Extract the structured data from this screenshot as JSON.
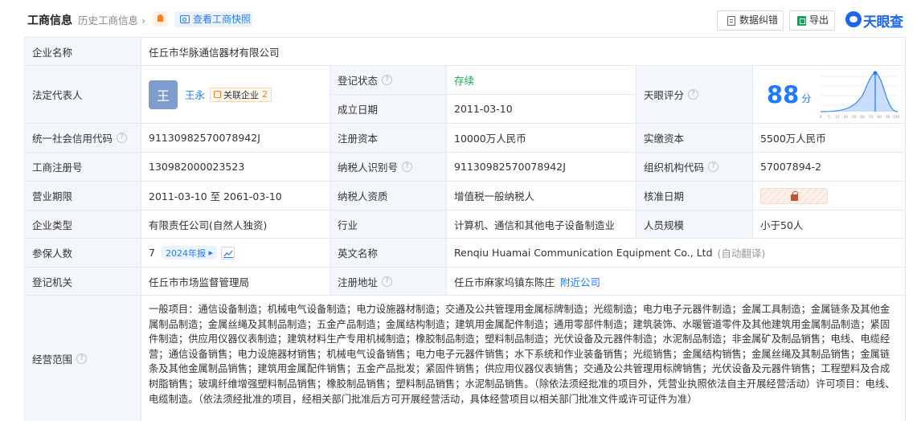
{
  "header": {
    "title": "工商信息",
    "history_link": "历史工商信息",
    "snapshot_button": "查看工商快照",
    "correct_button": "数据纠错",
    "export_button": "导出",
    "logo_text": "天眼查",
    "accent_color": "#1f7bff"
  },
  "company": {
    "name_label": "企业名称",
    "name": "任丘市华脉通信器材有限公司",
    "legal_rep_label": "法定代表人",
    "legal_rep_avatar": "王",
    "legal_rep_name": "王永",
    "related_label": "关联企业",
    "related_count": "2",
    "status_label": "登记状态",
    "status": "存续",
    "est_date_label": "成立日期",
    "est_date": "2011-03-10",
    "score_label": "天眼评分",
    "score": "88",
    "score_unit": "分",
    "score_axis": [
      "0",
      "5",
      "15",
      "30",
      "50",
      "60",
      "70",
      "80",
      "90",
      "100"
    ],
    "credit_code_label": "统一社会信用代码",
    "credit_code": "91130982570078942J",
    "reg_capital_label": "注册资本",
    "reg_capital": "10000万人民币",
    "paid_capital_label": "实缴资本",
    "paid_capital": "5500万人民币",
    "reg_no_label": "工商注册号",
    "reg_no": "130982000023523",
    "taxpayer_id_label": "纳税人识别号",
    "taxpayer_id": "91130982570078942J",
    "org_code_label": "组织机构代码",
    "org_code": "57007894-2",
    "term_label": "营业期限",
    "term": "2011-03-10 至 2061-03-10",
    "tax_qual_label": "纳税人资质",
    "tax_qual": "增值税一般纳税人",
    "approve_label": "核准日期",
    "type_label": "企业类型",
    "type": "有限责任公司(自然人独资)",
    "industry_label": "行业",
    "industry": "计算机、通信和其他电子设备制造业",
    "staff_label": "人员规模",
    "staff": "小于50人",
    "insured_label": "参保人数",
    "insured": "7",
    "insured_badge": "2024年报",
    "en_name_label": "英文名称",
    "en_name": "Renqiu Huamai Communication Equipment Co., Ltd",
    "auto_translate": "(自动翻译)",
    "authority_label": "登记机关",
    "authority": "任丘市市场监督管理局",
    "address_label": "注册地址",
    "address": "任丘市麻家坞镇东陈庄",
    "nearby_link": "附近公司",
    "scope_label": "经营范围",
    "scope": "一般项目：通信设备制造；机械电气设备制造；电力设施器材制造；交通及公共管理用金属标牌制造；光缆制造；电力电子元器件制造；金属工具制造；金属链条及其他金属制品制造；金属丝绳及其制品制造；五金产品制造；金属结构制造；建筑用金属配件制造；通用零部件制造；建筑装饰、水暖管道零件及其他建筑用金属制品制造；紧固件制造；供应用仪器仪表制造；建筑材料生产专用机械制造；橡胶制品制造；塑料制品制造；光伏设备及元器件制造；水泥制品制造；非金属矿及制品销售；电线、电缆经营；通信设备销售；电力设施器材销售；机械电气设备销售；电力电子元器件销售；水下系统和作业装备销售；光缆销售；金属结构销售；金属丝绳及其制品销售；金属链条及其他金属制品销售；建筑用金属配件销售；五金产品批发；紧固件销售；供应用仪器仪表销售；交通及公共管理用标牌销售；光伏设备及元器件销售；工程塑料及合成树脂销售；玻璃纤维增强塑料制品销售；橡胶制品销售；塑料制品销售；水泥制品销售。（除依法须经批准的项目外，凭营业执照依法自主开展经营活动）许可项目：电线、电缆制造。（依法须经批准的项目，经相关部门批准后方可开展经营活动，具体经营项目以相关部门批准文件或许可证件为准）"
  }
}
